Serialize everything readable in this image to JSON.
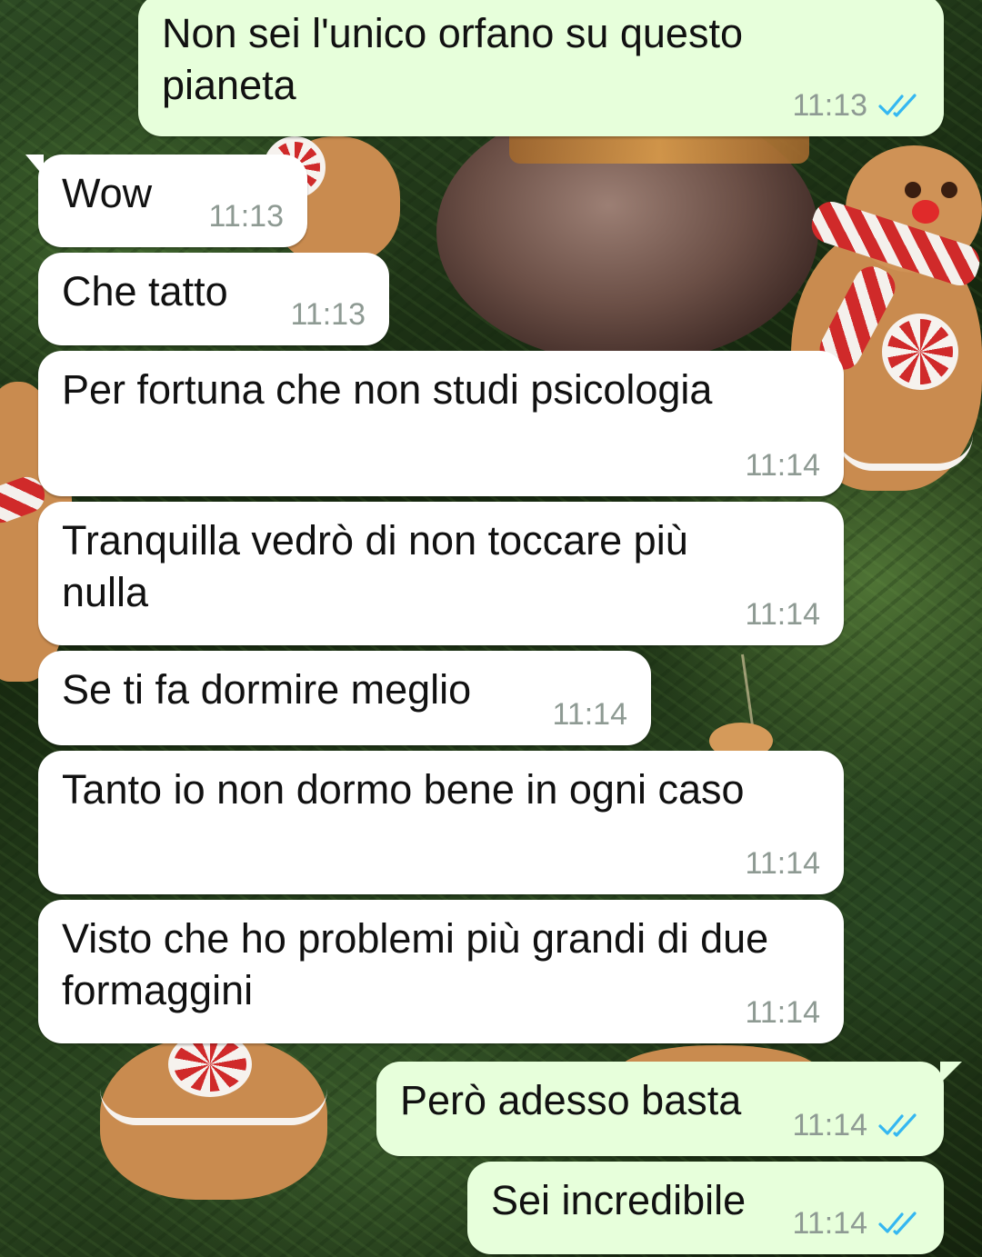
{
  "app": "WhatsApp chat",
  "colors": {
    "incoming_bubble": "#ffffff",
    "outgoing_bubble": "#e7ffdb",
    "time_text": "#8e9a93",
    "read_ticks": "#34b7f1"
  },
  "messages": [
    {
      "direction": "outgoing",
      "text": "Non sei l'unico orfano su questo\npianeta",
      "time": "11:13",
      "status": "read",
      "status_icon": "double-check-icon"
    },
    {
      "direction": "incoming",
      "text": "Wow",
      "time": "11:13"
    },
    {
      "direction": "incoming",
      "text": "Che tatto",
      "time": "11:13"
    },
    {
      "direction": "incoming",
      "text": "Per fortuna che non studi psicologia",
      "time": "11:14"
    },
    {
      "direction": "incoming",
      "text": "Tranquilla vedrò di non toccare più\nnulla",
      "time": "11:14"
    },
    {
      "direction": "incoming",
      "text": "Se ti fa dormire meglio",
      "time": "11:14"
    },
    {
      "direction": "incoming",
      "text": "Tanto io non dormo bene in ogni caso",
      "time": "11:14"
    },
    {
      "direction": "incoming",
      "text": "Visto che ho problemi più grandi di due\nformaggini",
      "time": "11:14"
    },
    {
      "direction": "outgoing",
      "text": "Però adesso basta",
      "time": "11:14",
      "status": "read",
      "status_icon": "double-check-icon"
    },
    {
      "direction": "outgoing",
      "text": "Sei incredibile",
      "time": "11:14",
      "status": "read",
      "status_icon": "double-check-icon"
    }
  ]
}
